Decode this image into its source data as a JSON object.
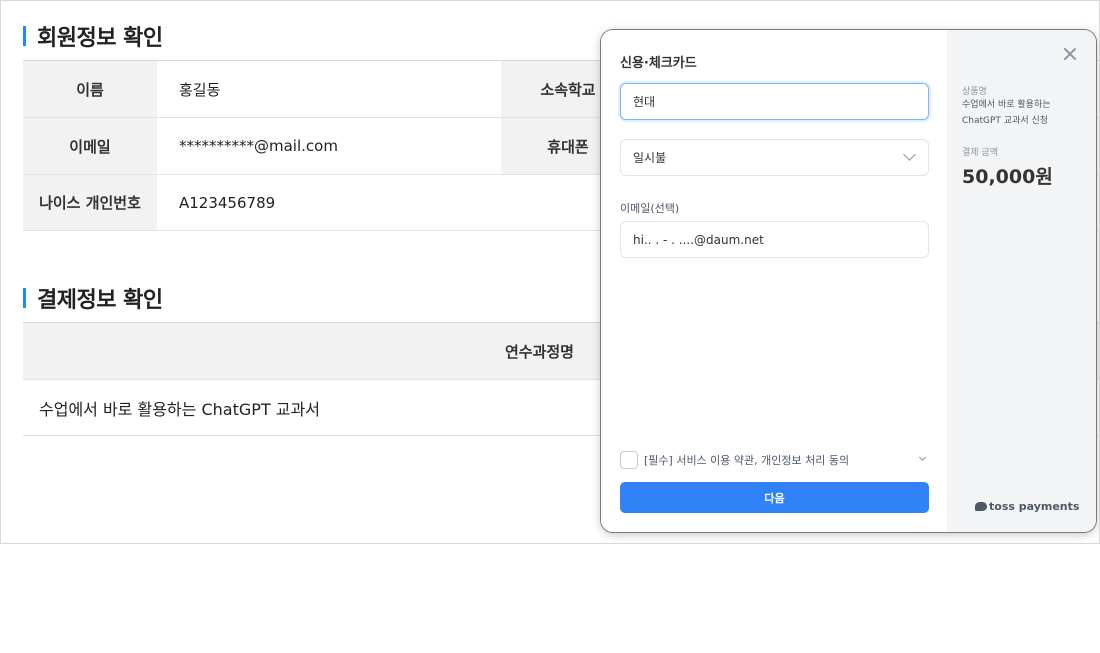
{
  "member_section": {
    "title": "회원정보 확인",
    "rows": [
      {
        "label": "이름",
        "value": "홍길동",
        "label2": "소속학교",
        "value2": ""
      },
      {
        "label": "이메일",
        "value": "**********@mail.com",
        "label2": "휴대폰",
        "value2": ""
      },
      {
        "label": "나이스 개인번호",
        "value": "A123456789"
      }
    ]
  },
  "payment_section": {
    "title": "결제정보 확인",
    "column_header": "연수과정명",
    "course_name": "수업에서 바로 활용하는 ChatGPT 교과서"
  },
  "payment_modal": {
    "title": "신용·체크카드",
    "card_company": "현대",
    "installment": "일시불",
    "email_label": "이메일(선택)",
    "email_value": "hi.. . - . ....@daum.net",
    "agreement_label": "[필수] 서비스 이용 약관, 개인정보 처리 동의",
    "next_button": "다음",
    "product_label": "상품명",
    "product_name": "수업에서 바로 활용하는 ChatGPT 교과서 신청",
    "amount_label": "결제 금액",
    "amount": "50,000원",
    "brand": "toss payments",
    "accent_color": "#3182f6"
  }
}
